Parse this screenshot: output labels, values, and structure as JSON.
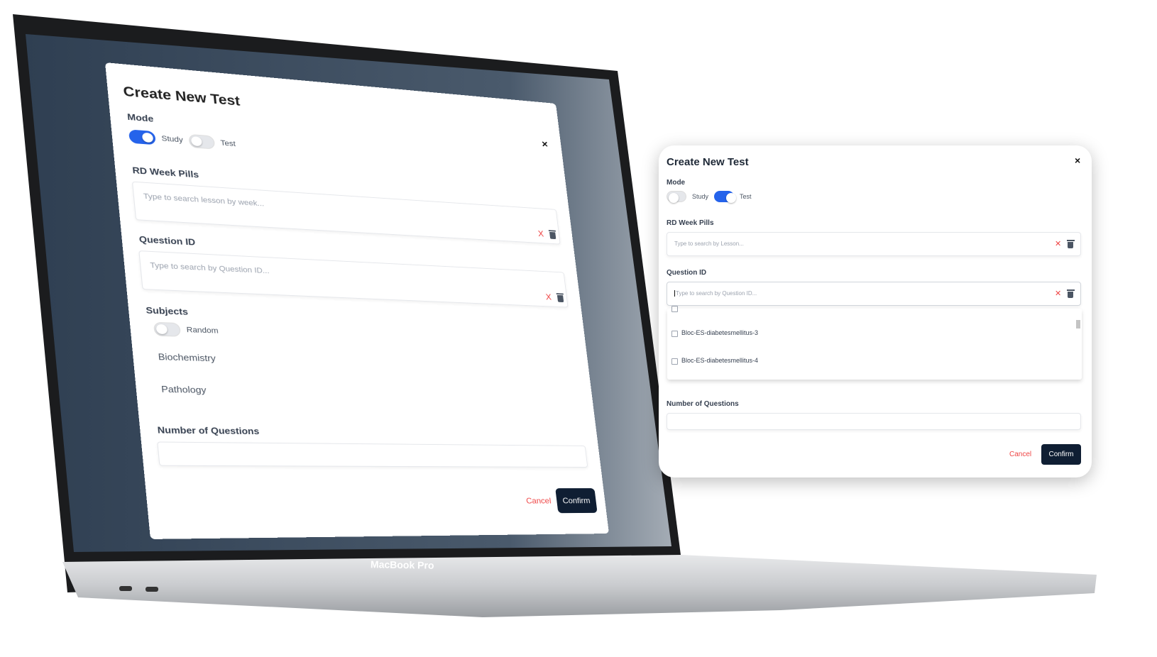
{
  "laptop": {
    "brand": "MacBook Pro"
  },
  "laptop_modal": {
    "title": "Create New Test",
    "close": "×",
    "mode_label": "Mode",
    "study_label": "Study",
    "study_on": true,
    "test_label": "Test",
    "test_on": false,
    "rd_label": "RD Week Pills",
    "rd_placeholder": "Type to search lesson by week...",
    "qid_label": "Question ID",
    "qid_placeholder": "Type to search by Question ID...",
    "subjects_label": "Subjects",
    "random_label": "Random",
    "random_on": false,
    "subjects": [
      "Biochemistry",
      "Pathology"
    ],
    "num_label": "Number of Questions",
    "num_value": "",
    "cancel": "Cancel",
    "confirm": "Confirm",
    "clear": "X"
  },
  "card_modal": {
    "title": "Create New Test",
    "close": "×",
    "mode_label": "Mode",
    "study_label": "Study",
    "study_on": false,
    "test_label": "Test",
    "test_on": true,
    "rd_label": "RD Week Pills",
    "rd_placeholder": "Type to search by Lesson...",
    "qid_label": "Question ID",
    "qid_placeholder": "Type to search by Question ID...",
    "dropdown_options": [
      "Bloc-ES-diabetesmellitus-3",
      "Bloc-ES-diabetesmellitus-4"
    ],
    "num_label": "Number of Questions",
    "num_value": "",
    "cancel": "Cancel",
    "confirm": "Confirm",
    "clear": "✕"
  },
  "colors": {
    "accent": "#2563eb",
    "confirm_bg": "#0f1e33",
    "cancel": "#ef4444"
  }
}
